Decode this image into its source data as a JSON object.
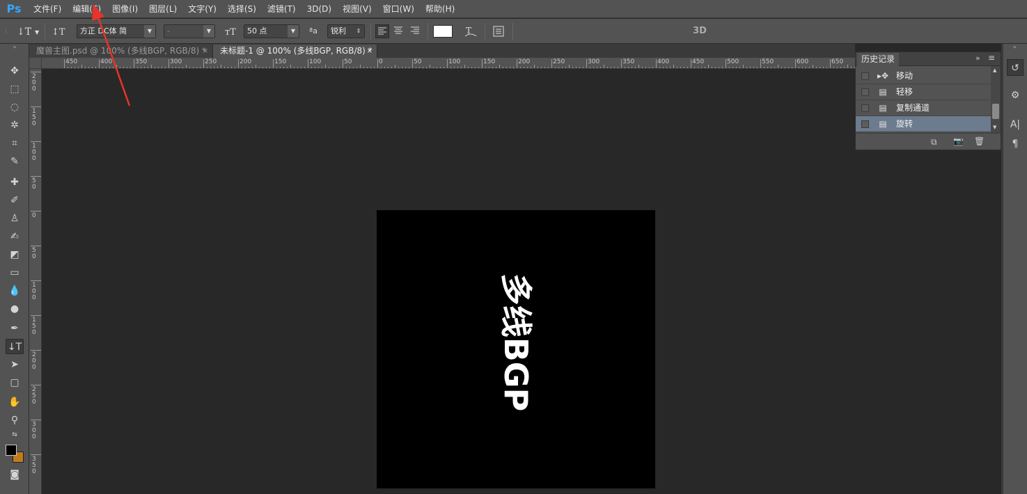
{
  "app": {
    "logo": "Ps"
  },
  "menu": [
    "文件(F)",
    "编辑(E)",
    "图像(I)",
    "图层(L)",
    "文字(Y)",
    "选择(S)",
    "滤镜(T)",
    "3D(D)",
    "视图(V)",
    "窗口(W)",
    "帮助(H)"
  ],
  "options": {
    "font_family": "方正 DC体 简",
    "font_style": "-",
    "font_size": "50 点",
    "antialias_icon": "ªa",
    "antialias": "锐利",
    "label_3d": "3D",
    "text_color": "#ffffff"
  },
  "tabs": [
    {
      "label": "魔兽主图.psd @ 100% (多线BGP, RGB/8) *",
      "close": "×"
    },
    {
      "label": "未标题-1 @ 100% (多线BGP, RGB/8) *",
      "close": "×"
    }
  ],
  "ruler_top_labels": [
    "450",
    "400",
    "350",
    "300",
    "250",
    "200",
    "150",
    "100",
    "50",
    "0",
    "50",
    "100",
    "150",
    "200",
    "250",
    "300",
    "350",
    "400",
    "450",
    "500",
    "550",
    "600",
    "650"
  ],
  "ruler_left_labels": [
    "200",
    "150",
    "100",
    "50",
    "0",
    "50",
    "100",
    "150",
    "200",
    "250",
    "300",
    "350"
  ],
  "canvas": {
    "text": "多线BGP",
    "background": "#000000",
    "text_color": "#ffffff"
  },
  "history": {
    "title": "历史记录",
    "collapse_icon": "»",
    "menu_icon": "≡",
    "items": [
      {
        "label": "移动",
        "icon": "move-icon",
        "selected": false
      },
      {
        "label": "轻移",
        "icon": "document-icon",
        "selected": false
      },
      {
        "label": "复制通道",
        "icon": "document-icon",
        "selected": false
      },
      {
        "label": "旋转",
        "icon": "document-icon",
        "selected": true
      }
    ]
  },
  "colors": {
    "foreground": "#000000",
    "background": "#c07a1a",
    "annotation": "#e8332a",
    "accent": "#31a8ff"
  }
}
